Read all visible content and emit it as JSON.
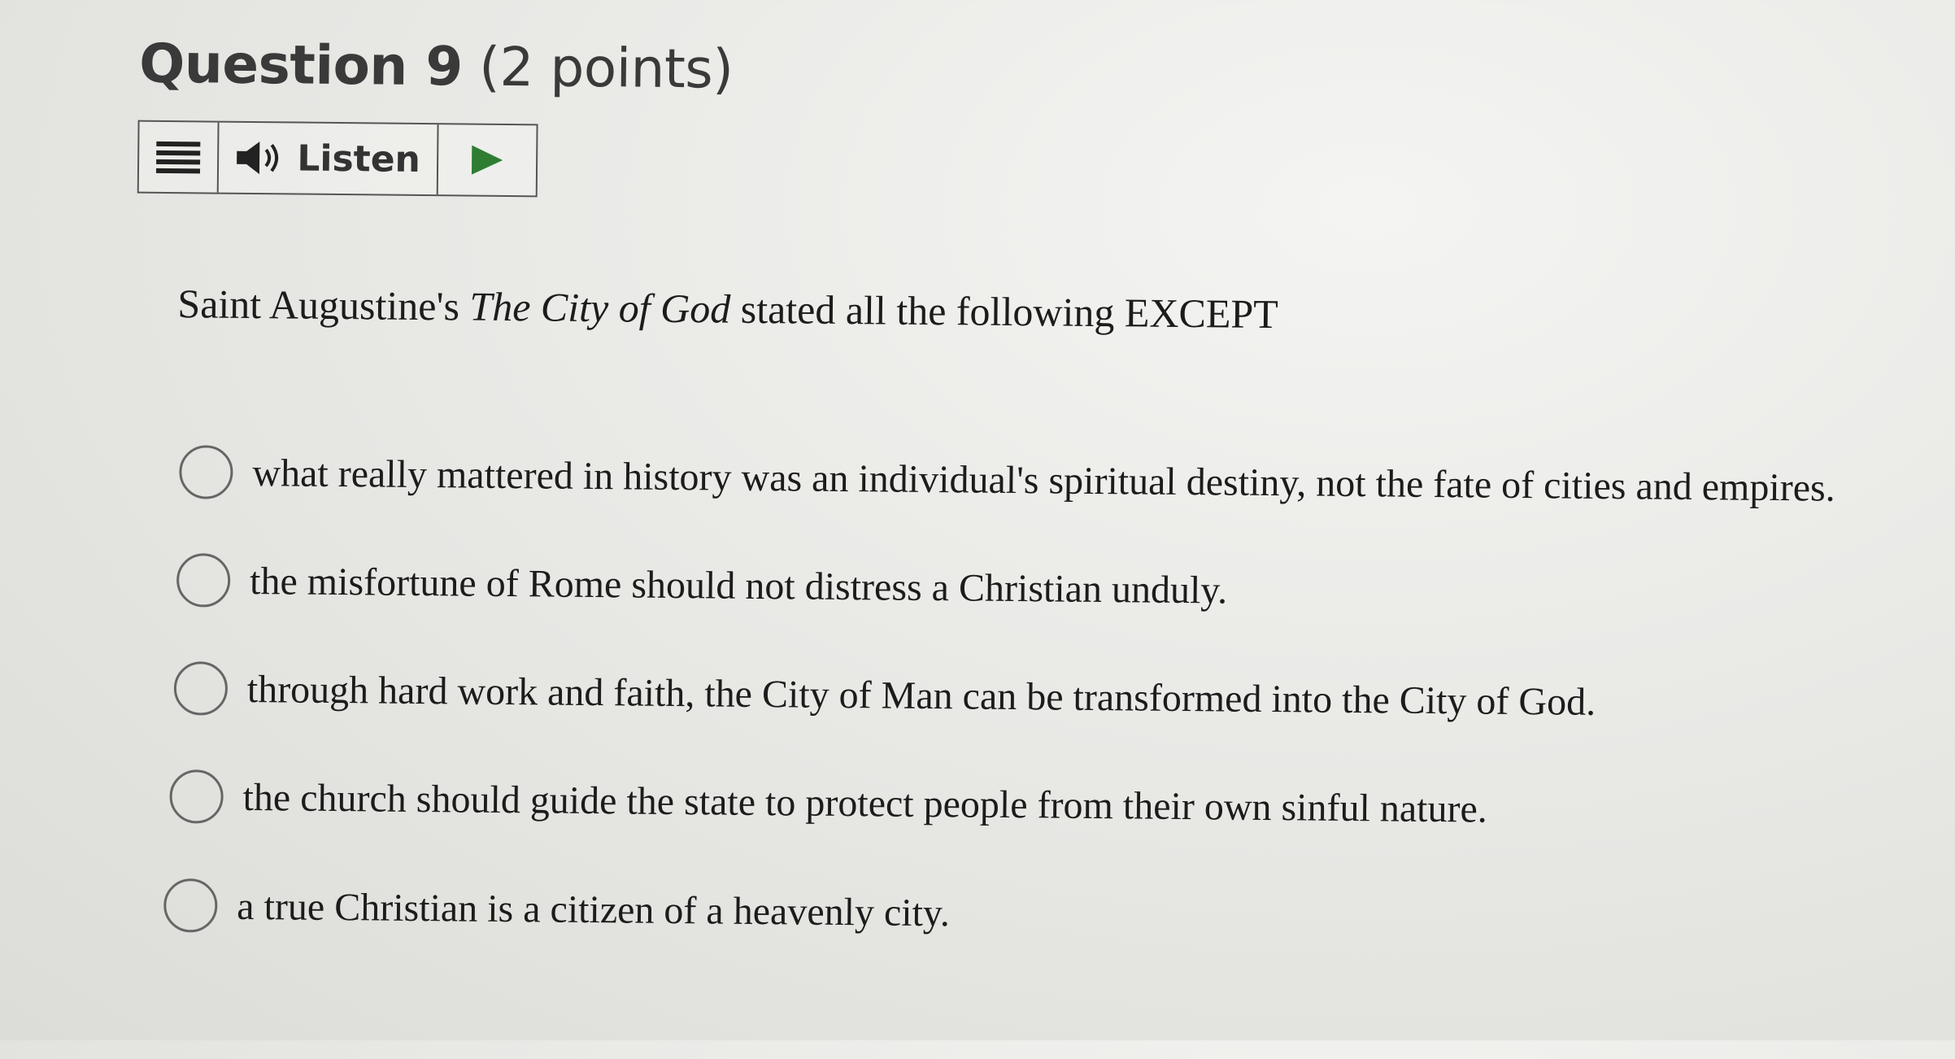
{
  "question": {
    "number_label": "Question 9",
    "points_label": "(2 points)"
  },
  "listen_bar": {
    "menu_icon": "menu-icon",
    "speaker_icon": "speaker-icon",
    "listen_label": "Listen",
    "play_icon": "play-icon",
    "accent_color": "#2e7d32"
  },
  "prompt": {
    "before": "Saint Augustine's ",
    "italic_title": "The City of God",
    "after": " stated all the following EXCEPT"
  },
  "options": [
    {
      "label": "what really mattered in history was an individual's spiritual destiny, not the fate of cities and empires.",
      "selected": false
    },
    {
      "label": "the misfortune of Rome should not distress a Christian unduly.",
      "selected": false
    },
    {
      "label": "through hard work and faith, the City of Man can be transformed into the City of God.",
      "selected": false
    },
    {
      "label": "the church should guide the state to protect people from their own sinful nature.",
      "selected": false
    },
    {
      "label": "a true Christian is a citizen of a heavenly city.",
      "selected": false
    }
  ]
}
